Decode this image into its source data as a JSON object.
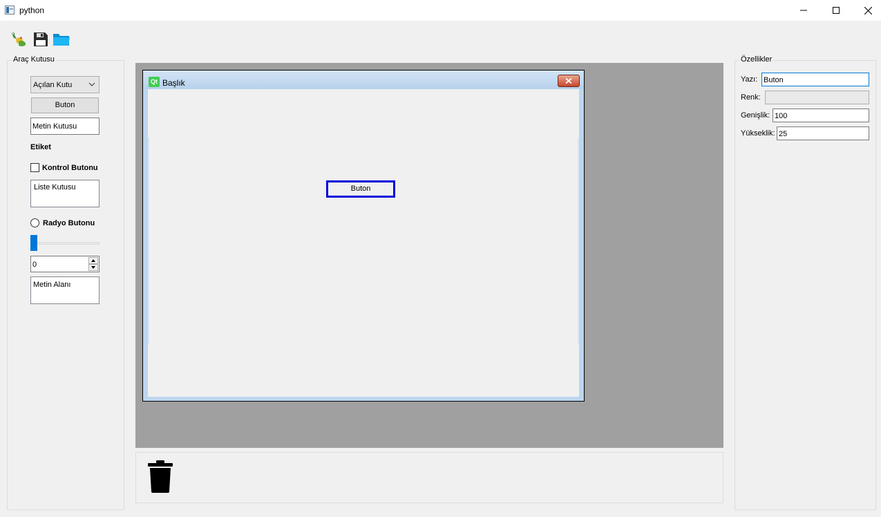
{
  "window": {
    "title": "python",
    "controls": [
      "minimize-icon",
      "maximize-icon",
      "close-icon"
    ]
  },
  "toolbar": {
    "icons": [
      "python-icon",
      "save-icon",
      "open-folder-icon"
    ]
  },
  "toolbox": {
    "title": "Araç Kutusu",
    "combo_label": "Açılan Kutu",
    "button_label": "Buton",
    "lineedit_text": "Metin Kutusu",
    "label_text": "Etiket",
    "checkbox_label": "Kontrol Butonu",
    "listbox_text": "Liste Kutusu",
    "radio_label": "Radyo Butonu",
    "slider_value_fraction": 0.0,
    "spin_value": "0",
    "textarea_text": "Metin Alanı"
  },
  "design_window": {
    "title": "Başlık",
    "icon": "qt-icon",
    "button_label": "Buton"
  },
  "trash": {
    "icon": "trash-icon"
  },
  "properties": {
    "title": "Özellikler",
    "yazi_label": "Yazı:",
    "yazi_value": "Buton",
    "renk_label": "Renk:",
    "renk_value": "",
    "genislik_label": "Genişlik:",
    "genislik_value": "100",
    "yukseklik_label": "Yükseklik:",
    "yukseklik_value": "25"
  },
  "colors": {
    "accent": "#0078d7",
    "selection_border": "#0000dd",
    "canvas_bg": "#a0a0a0",
    "qt_green": "#41cd52"
  }
}
